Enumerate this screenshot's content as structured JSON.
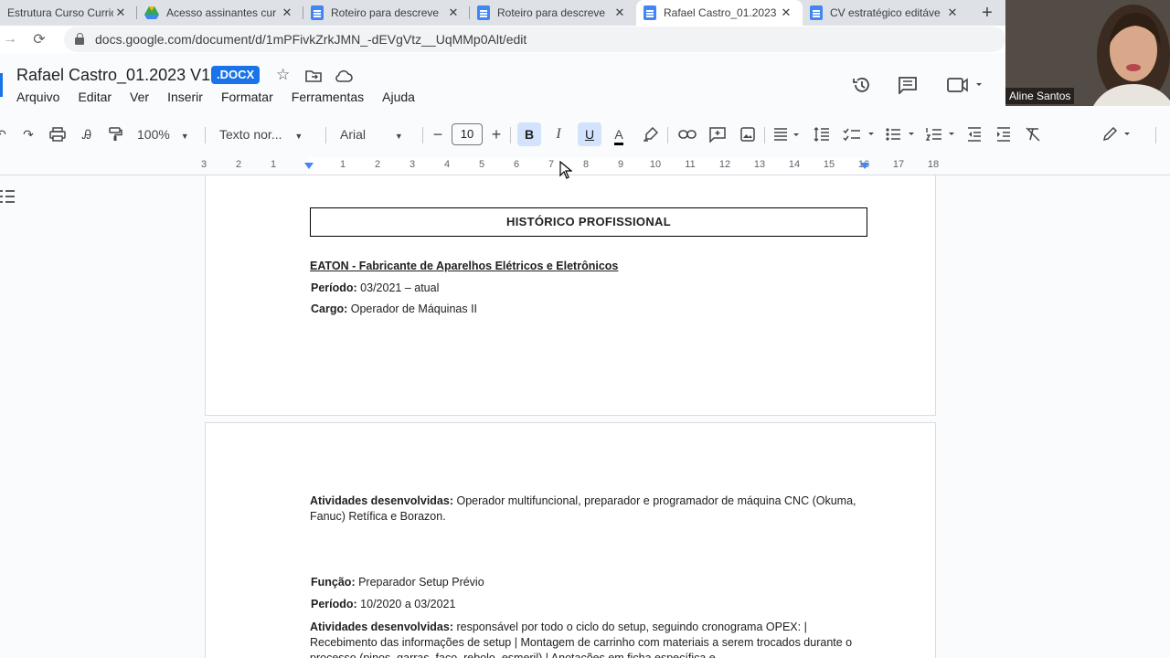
{
  "browser": {
    "tabs": [
      {
        "title": "Estrutura Curso Curric",
        "icon": "no-favicon",
        "active": false
      },
      {
        "title": "Acesso assinantes cur",
        "icon": "drive-icon",
        "active": false
      },
      {
        "title": "Roteiro para descreve",
        "icon": "docs-icon",
        "active": false
      },
      {
        "title": "Roteiro para descreve",
        "icon": "docs-icon",
        "active": false
      },
      {
        "title": "Rafael Castro_01.2023",
        "icon": "docs-icon",
        "active": true
      },
      {
        "title": "CV estratégico editáve",
        "icon": "docs-icon",
        "active": false
      }
    ],
    "new_tab": "+",
    "url": "docs.google.com/document/d/1mPFivkZrkJMN_-dEVgVtz__UqMMp0Alt/edit"
  },
  "docs": {
    "title": "Rafael Castro_01.2023 V1",
    "badge": ".DOCX",
    "menu": [
      "Arquivo",
      "Editar",
      "Ver",
      "Inserir",
      "Formatar",
      "Ferramentas",
      "Ajuda"
    ],
    "toolbar": {
      "zoom": "100%",
      "style": "Texto nor...",
      "font": "Arial",
      "font_size": "10",
      "bold": "B",
      "italic": "I",
      "underline": "U",
      "text_color": "A"
    },
    "ruler": [
      "3",
      "2",
      "1",
      "1",
      "2",
      "3",
      "4",
      "5",
      "6",
      "7",
      "8",
      "9",
      "10",
      "11",
      "12",
      "13",
      "14",
      "15",
      "16",
      "17",
      "18"
    ]
  },
  "document": {
    "section_title": "HISTÓRICO PROFISSIONAL",
    "company": "EATON - Fabricante de Aparelhos Elétricos e Eletrônicos",
    "period_label": "Período:",
    "period_value": " 03/2021  – atual",
    "role_label": "Cargo:",
    "role_value": " Operador de Máquinas II",
    "activities1_label": "Atividades desenvolvidas:",
    "activities1_value": " Operador multifuncional, preparador e programador de máquina CNC (Okuma, Fanuc) Retífica e Borazon.",
    "function_label": "Função:",
    "function_value": " Preparador Setup Prévio",
    "period2_label": "Período:",
    "period2_value": " 10/2020 a 03/2021",
    "activities2_label": "Atividades desenvolvidas:",
    "activities2_value": " responsável por todo o ciclo do setup, seguindo cronograma OPEX: | Recebimento das informações de setup | Montagem de carrinho com materiais a serem trocados durante o processo (pinos, garras, faco, rebolo, esmeril) | Anotações em ficha específica e"
  },
  "meet": {
    "participant_name": "Aline Santos"
  }
}
